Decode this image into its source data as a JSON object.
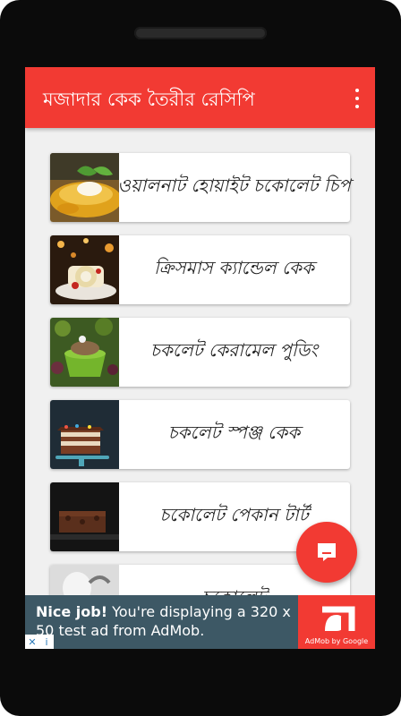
{
  "app": {
    "title": "মজাদার কেক তৈরীর রেসিপি",
    "accent_color": "#f23a33"
  },
  "recipes": [
    {
      "label": "ওয়ালনাট হোয়াইট চকোলেট চিপ",
      "image": "walnut-tart-photo"
    },
    {
      "label": "ক্রিসমাস ক্যান্ডেল কেক",
      "image": "christmas-roll-cake-photo"
    },
    {
      "label": "চকলেট কেরামেল পুডিং",
      "image": "pudding-bowl-photo"
    },
    {
      "label": "চকলেট স্পঞ্জ কেক",
      "image": "sponge-cake-photo"
    },
    {
      "label": "চকোলেট পেকান টার্ট",
      "image": "pecan-tart-photo"
    },
    {
      "label": "চকোলেট",
      "image": "partial-cake-photo"
    }
  ],
  "fab": {
    "icon": "chat-icon"
  },
  "ad": {
    "headline": "Nice job!",
    "body": " You're displaying a 320 x 50 test ad from AdMob.",
    "brand": "AdMob by Google",
    "adchoices_close": "✕",
    "adchoices_info": "i"
  }
}
